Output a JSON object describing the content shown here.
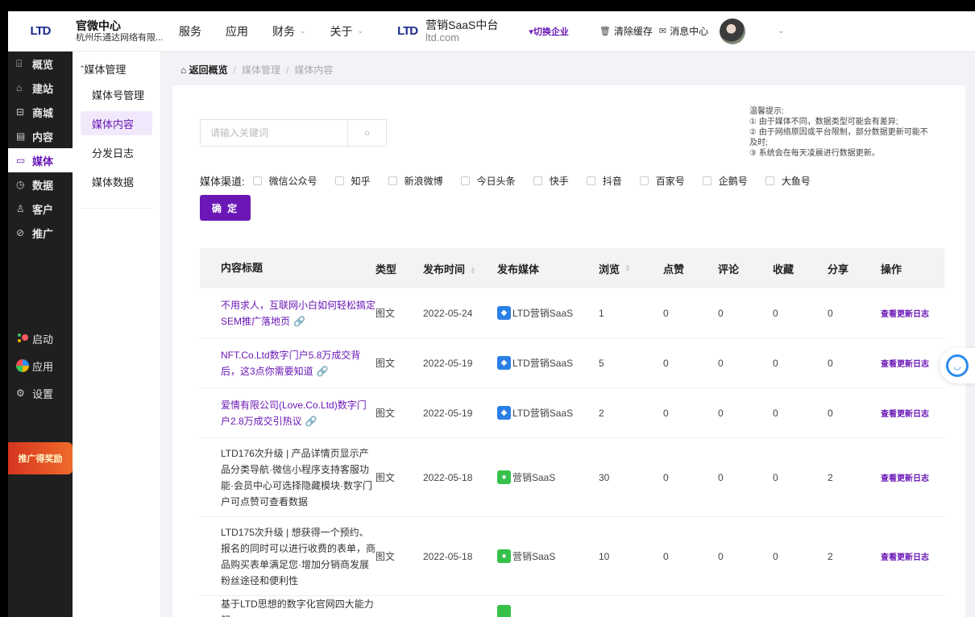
{
  "header": {
    "logo_text": "LTD",
    "org_title": "官微中心",
    "org_sub": "杭州乐通达网络有限...",
    "nav": [
      {
        "label": "服务",
        "has_menu": false
      },
      {
        "label": "应用",
        "has_menu": false
      },
      {
        "label": "财务",
        "has_menu": true
      },
      {
        "label": "关于",
        "has_menu": true
      }
    ],
    "brand_logo": "LTD",
    "brand_title": "营销SaaS中台",
    "brand_sub": "ltd.com",
    "switch_label": "▾切换企业",
    "clear_cache": "清除缓存",
    "messages": "消息中心"
  },
  "sidebar": {
    "items": [
      {
        "icon": "chart-icon",
        "glyph": "⌸",
        "label": "概览"
      },
      {
        "icon": "home-icon",
        "glyph": "⌂",
        "label": "建站"
      },
      {
        "icon": "cart-icon",
        "glyph": "⊟",
        "label": "商城"
      },
      {
        "icon": "document-icon",
        "glyph": "▤",
        "label": "内容"
      },
      {
        "icon": "media-icon",
        "glyph": "▭",
        "label": "媒体",
        "active": true
      },
      {
        "icon": "pie-icon",
        "glyph": "◷",
        "label": "数据"
      },
      {
        "icon": "user-icon",
        "glyph": "♙",
        "label": "客户"
      },
      {
        "icon": "promote-icon",
        "glyph": "⊘",
        "label": "推广"
      }
    ],
    "bottom": [
      {
        "icon": "launch-icon",
        "label": "启动"
      },
      {
        "icon": "apps-icon",
        "label": "应用"
      },
      {
        "icon": "settings-icon",
        "glyph": "⚙",
        "label": "设置"
      }
    ],
    "promo_text": "推广得奖励"
  },
  "submenu": {
    "head": "媒体管理",
    "items": [
      "媒体号管理",
      "媒体内容",
      "分发日志",
      "媒体数据"
    ],
    "active_index": 1
  },
  "breadcrumb": {
    "home": "返回概览",
    "items": [
      "媒体管理",
      "媒体内容"
    ]
  },
  "search": {
    "placeholder": "请输入关键词",
    "value": ""
  },
  "tips": {
    "title": "温馨提示:",
    "lines": [
      "① 由于媒体不同，数据类型可能会有差异;",
      "② 由于网络原因或平台限制，部分数据更新可能不及时;",
      "③ 系统会在每天凌晨进行数据更新。"
    ]
  },
  "channels": {
    "label": "媒体渠道:",
    "options": [
      "微信公众号",
      "知乎",
      "新浪微博",
      "今日头条",
      "快手",
      "抖音",
      "百家号",
      "企鹅号",
      "大鱼号"
    ]
  },
  "confirm_label": "确 定",
  "table": {
    "headers": {
      "title": "内容标题",
      "type": "类型",
      "time": "发布时间",
      "media": "发布媒体",
      "views": "浏览",
      "likes": "点赞",
      "comments": "评论",
      "favorites": "收藏",
      "shares": "分享",
      "actions": "操作"
    },
    "rows": [
      {
        "title": "不用求人，互联网小白如何轻松搞定SEM推广落地页",
        "link": true,
        "type": "图文",
        "time": "2022-05-24",
        "media": "LTD营销SaaS",
        "media_icon": "blue",
        "views": "1",
        "likes": "0",
        "comments": "0",
        "favorites": "0",
        "shares": "0",
        "action": "查看更新日志"
      },
      {
        "title": "NFT.Co.Ltd数字门户5.8万成交背后，这3点你需要知道",
        "link": true,
        "type": "图文",
        "time": "2022-05-19",
        "media": "LTD营销SaaS",
        "media_icon": "blue",
        "views": "5",
        "likes": "0",
        "comments": "0",
        "favorites": "0",
        "shares": "0",
        "action": "查看更新日志"
      },
      {
        "title": "爱情有限公司(Love.Co.Ltd)数字门户2.8万成交引热议",
        "link": true,
        "type": "图文",
        "time": "2022-05-19",
        "media": "LTD营销SaaS",
        "media_icon": "blue",
        "views": "2",
        "likes": "0",
        "comments": "0",
        "favorites": "0",
        "shares": "0",
        "action": "查看更新日志"
      },
      {
        "title": "LTD176次升级 | 产品详情页显示产品分类导航·微信小程序支持客服功能·会员中心可选择隐藏模块·数字门户可点赞可查看数据",
        "link": false,
        "type": "图文",
        "time": "2022-05-18",
        "media": "营销SaaS",
        "media_icon": "green",
        "views": "30",
        "likes": "0",
        "comments": "0",
        "favorites": "0",
        "shares": "2",
        "action": "查看更新日志"
      },
      {
        "title": "LTD175次升级 | 想获得一个预约、报名的同时可以进行收费的表单，商品购买表单满足您·增加分销商发展粉丝途径和便利性",
        "link": false,
        "type": "图文",
        "time": "2022-05-18",
        "media": "营销SaaS",
        "media_icon": "green",
        "views": "10",
        "likes": "0",
        "comments": "0",
        "favorites": "0",
        "shares": "2",
        "action": "查看更新日志"
      },
      {
        "title": "基于LTD思想的数字化官网四大能力解",
        "link": false,
        "type": "",
        "time": "",
        "media": "",
        "media_icon": "green",
        "views": "",
        "likes": "",
        "comments": "",
        "favorites": "",
        "shares": "",
        "action": ""
      }
    ]
  },
  "colors": {
    "accent": "#6a17b6",
    "sidebar_bg": "#1f1f1f",
    "page_bg": "#f2f3f7"
  }
}
